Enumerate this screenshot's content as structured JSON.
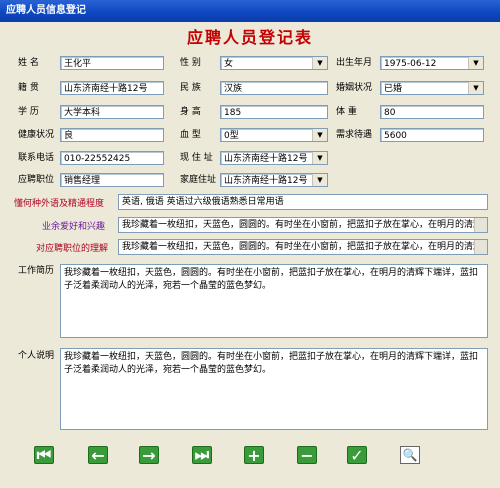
{
  "window": {
    "title": "应聘人员信息登记"
  },
  "form": {
    "title": "应聘人员登记表"
  },
  "fields": {
    "name": {
      "label": "姓  名",
      "value": "王化平"
    },
    "gender": {
      "label": "性  别",
      "value": "女"
    },
    "birth": {
      "label": "出生年月",
      "value": "1975-06-12"
    },
    "origin": {
      "label": "籍  贯",
      "value": "山东济南经十路12号"
    },
    "ethnic": {
      "label": "民  族",
      "value": "汉族"
    },
    "marital": {
      "label": "婚姻状况",
      "value": "已婚"
    },
    "education": {
      "label": "学  历",
      "value": "大学本科"
    },
    "height": {
      "label": "身  高",
      "value": "185"
    },
    "weight": {
      "label": "体  重",
      "value": "80"
    },
    "health": {
      "label": "健康状况",
      "value": "良"
    },
    "blood": {
      "label": "血  型",
      "value": "0型"
    },
    "salary": {
      "label": "需求待遇",
      "value": "5600"
    },
    "phone": {
      "label": "联系电话",
      "value": "010-22552425"
    },
    "address": {
      "label": "现 住 址",
      "value": "山东济南经十路12号"
    },
    "position": {
      "label": "应聘职位",
      "value": "销售经理"
    },
    "home": {
      "label": "家庭住址",
      "value": "山东济南经十路12号"
    }
  },
  "memos": {
    "language": {
      "label": "懂何种外语及精通程度",
      "value": "英语, 俄语  英语过六级俄语熟悉日常用语"
    },
    "hobby": {
      "label": "业余爱好和兴趣",
      "value": "我珍藏着一枚纽扣，天蓝色，圆圆的。有时坐在小窗前，把蓝扣子放在掌心，在明月的清辉"
    },
    "understanding": {
      "label": "对应聘职位的理解",
      "value": "我珍藏着一枚纽扣，天蓝色，圆圆的。有时坐在小窗前，把蓝扣子放在掌心，在明月的清辉"
    },
    "work": {
      "label": "工作简历",
      "value": "我珍藏着一枚纽扣，天蓝色，圆圆的。有时坐在小窗前，把蓝扣子放在掌心，在明月的清辉下端详，蓝扣子泛着柔润动人的光泽，宛若一个晶莹的蓝色梦幻。"
    },
    "personal": {
      "label": "个人说明",
      "value": "我珍藏着一枚纽扣，天蓝色，圆圆的。有时坐在小窗前，把蓝扣子放在掌心，在明月的清辉下端详，蓝扣子泛着柔润动人的光泽，宛若一个晶莹的蓝色梦幻。"
    }
  },
  "toolbar": {
    "buttons": [
      {
        "name": "first-record",
        "icon": "first-icon"
      },
      {
        "name": "prev-record",
        "icon": "prev-icon"
      },
      {
        "name": "next-record",
        "icon": "next-icon"
      },
      {
        "name": "last-record",
        "icon": "last-icon"
      },
      {
        "name": "add-record",
        "icon": "plus-icon"
      },
      {
        "name": "delete-record",
        "icon": "minus-icon"
      },
      {
        "name": "save-record",
        "icon": "check-icon"
      },
      {
        "name": "search-record",
        "icon": "search-icon"
      }
    ]
  },
  "colors": {
    "title_red": "#c40000",
    "label_red": "#b00020",
    "label_purple": "#6a1b9a",
    "nav_green": "#3a9b3a"
  }
}
